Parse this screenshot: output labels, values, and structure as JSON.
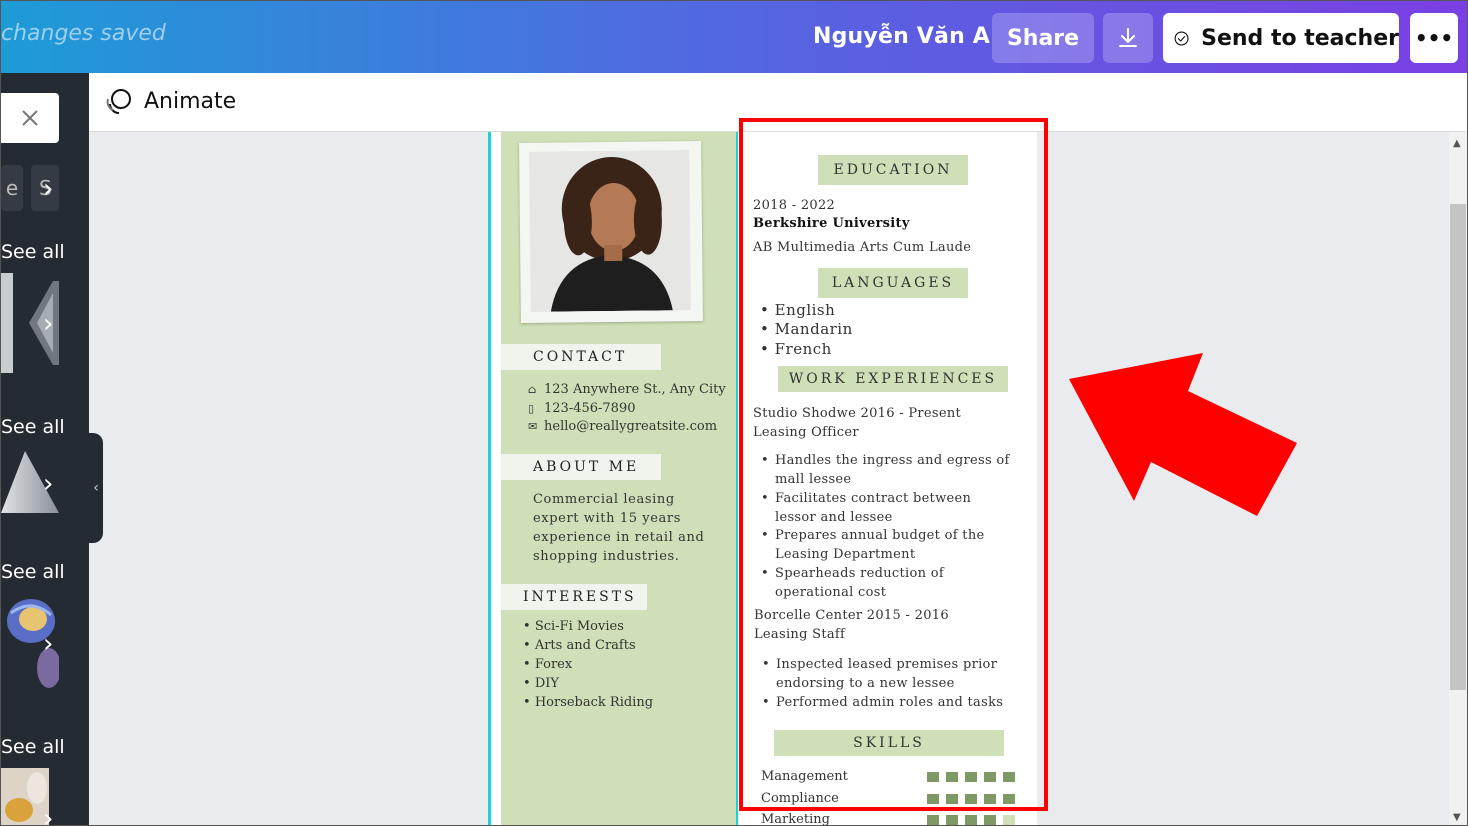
{
  "topbar": {
    "saved_text": "changes saved",
    "user_name": "Nguyễn Văn A",
    "share_label": "Share",
    "download_icon": "download-icon",
    "send_label": "Send to teacher",
    "send_icon": "check-circle-icon",
    "more_label": "•••"
  },
  "sidebar": {
    "close_icon": "close-icon",
    "chip_left": "e",
    "chip_right": "S",
    "see_all": [
      "See all",
      "See all",
      "See all",
      "See all"
    ],
    "chevron": "›",
    "collapse": "‹"
  },
  "animate": {
    "label": "Animate"
  },
  "resume": {
    "contact": {
      "title": "CONTACT",
      "address": "123 Anywhere St., Any City",
      "phone": "123-456-7890",
      "email": "hello@reallygreatsite.com"
    },
    "about": {
      "title": "ABOUT  ME",
      "text": "Commercial leasing expert with 15 years experience in retail and shopping industries."
    },
    "interests": {
      "title": "INTERESTS",
      "items": [
        "Sci-Fi Movies",
        "Arts and Crafts",
        "Forex",
        "DIY",
        "Horseback Riding"
      ]
    },
    "education": {
      "title": "EDUCATION",
      "years": "2018 - 2022",
      "school": "Berkshire University",
      "degree": "AB Multimedia Arts Cum Laude"
    },
    "languages": {
      "title": "LANGUAGES",
      "items": [
        "English",
        "Mandarin",
        "French"
      ]
    },
    "work": {
      "title": "WORK  EXPERIENCES",
      "jobs": [
        {
          "company": "Studio Shodwe 2016 - Present",
          "role": "Leasing Officer",
          "duties": [
            "Handles the ingress and egress of mall lessee",
            "Facilitates contract between lessor and lessee",
            "Prepares annual budget of the Leasing Department",
            "Spearheads reduction of operational cost"
          ]
        },
        {
          "company": "Borcelle Center 2015 - 2016",
          "role": "Leasing Staff",
          "duties": [
            "Inspected leased premises prior endorsing to a new lessee",
            "Performed admin roles and tasks"
          ]
        }
      ]
    },
    "skills": {
      "title": "SKILLS",
      "items": [
        {
          "name": "Management",
          "level": 5
        },
        {
          "name": "Compliance",
          "level": 5
        },
        {
          "name": "Marketing",
          "level": 4
        }
      ]
    }
  },
  "colors": {
    "accent_green": "#cfe0b8",
    "skill_green": "#7f9966",
    "highlight_red": "#ff0000",
    "guide_cyan": "#19d3da"
  }
}
